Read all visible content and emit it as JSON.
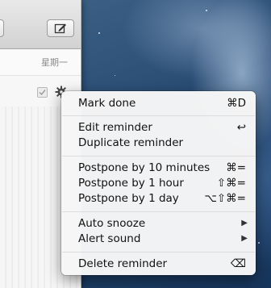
{
  "window": {
    "weekday_label": "星期一"
  },
  "context_menu": {
    "items": [
      {
        "label": "Mark done",
        "shortcut": "⌘D"
      },
      {
        "label": "Edit reminder",
        "shortcut": "↩"
      },
      {
        "label": "Duplicate reminder",
        "shortcut": ""
      },
      {
        "label": "Postpone by 10 minutes",
        "shortcut": "⌘="
      },
      {
        "label": "Postpone by 1 hour",
        "shortcut": "⇧⌘="
      },
      {
        "label": "Postpone by 1 day",
        "shortcut": "⌥⇧⌘="
      },
      {
        "label": "Auto snooze",
        "submenu_icon": "▶"
      },
      {
        "label": "Alert sound",
        "submenu_icon": "▶"
      },
      {
        "label": "Delete reminder",
        "shortcut": "⌫"
      }
    ]
  }
}
